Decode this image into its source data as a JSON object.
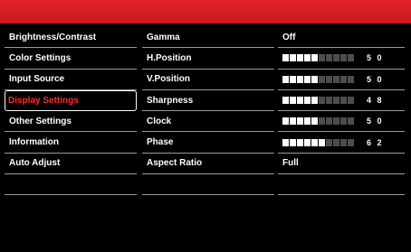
{
  "menu": [
    {
      "label": "Brightness/Contrast"
    },
    {
      "label": "Color Settings"
    },
    {
      "label": "Input Source"
    },
    {
      "label": "Display Settings",
      "selected": true
    },
    {
      "label": "Other Settings"
    },
    {
      "label": "Information"
    },
    {
      "label": "Auto Adjust"
    }
  ],
  "settings": [
    {
      "label": "Gamma",
      "value_text": "Off"
    },
    {
      "label": "H.Position",
      "value_text": "5 0",
      "level": 50
    },
    {
      "label": "V.Position",
      "value_text": "5 0",
      "level": 50
    },
    {
      "label": "Sharpness",
      "value_text": "4 8",
      "level": 48
    },
    {
      "label": "Clock",
      "value_text": "5 0",
      "level": 50
    },
    {
      "label": "Phase",
      "value_text": "6 2",
      "level": 62
    },
    {
      "label": "Aspect Ratio",
      "value_text": "Full"
    }
  ],
  "colors": {
    "header": "#d81f26",
    "selected_text": "#ff2b2b"
  }
}
